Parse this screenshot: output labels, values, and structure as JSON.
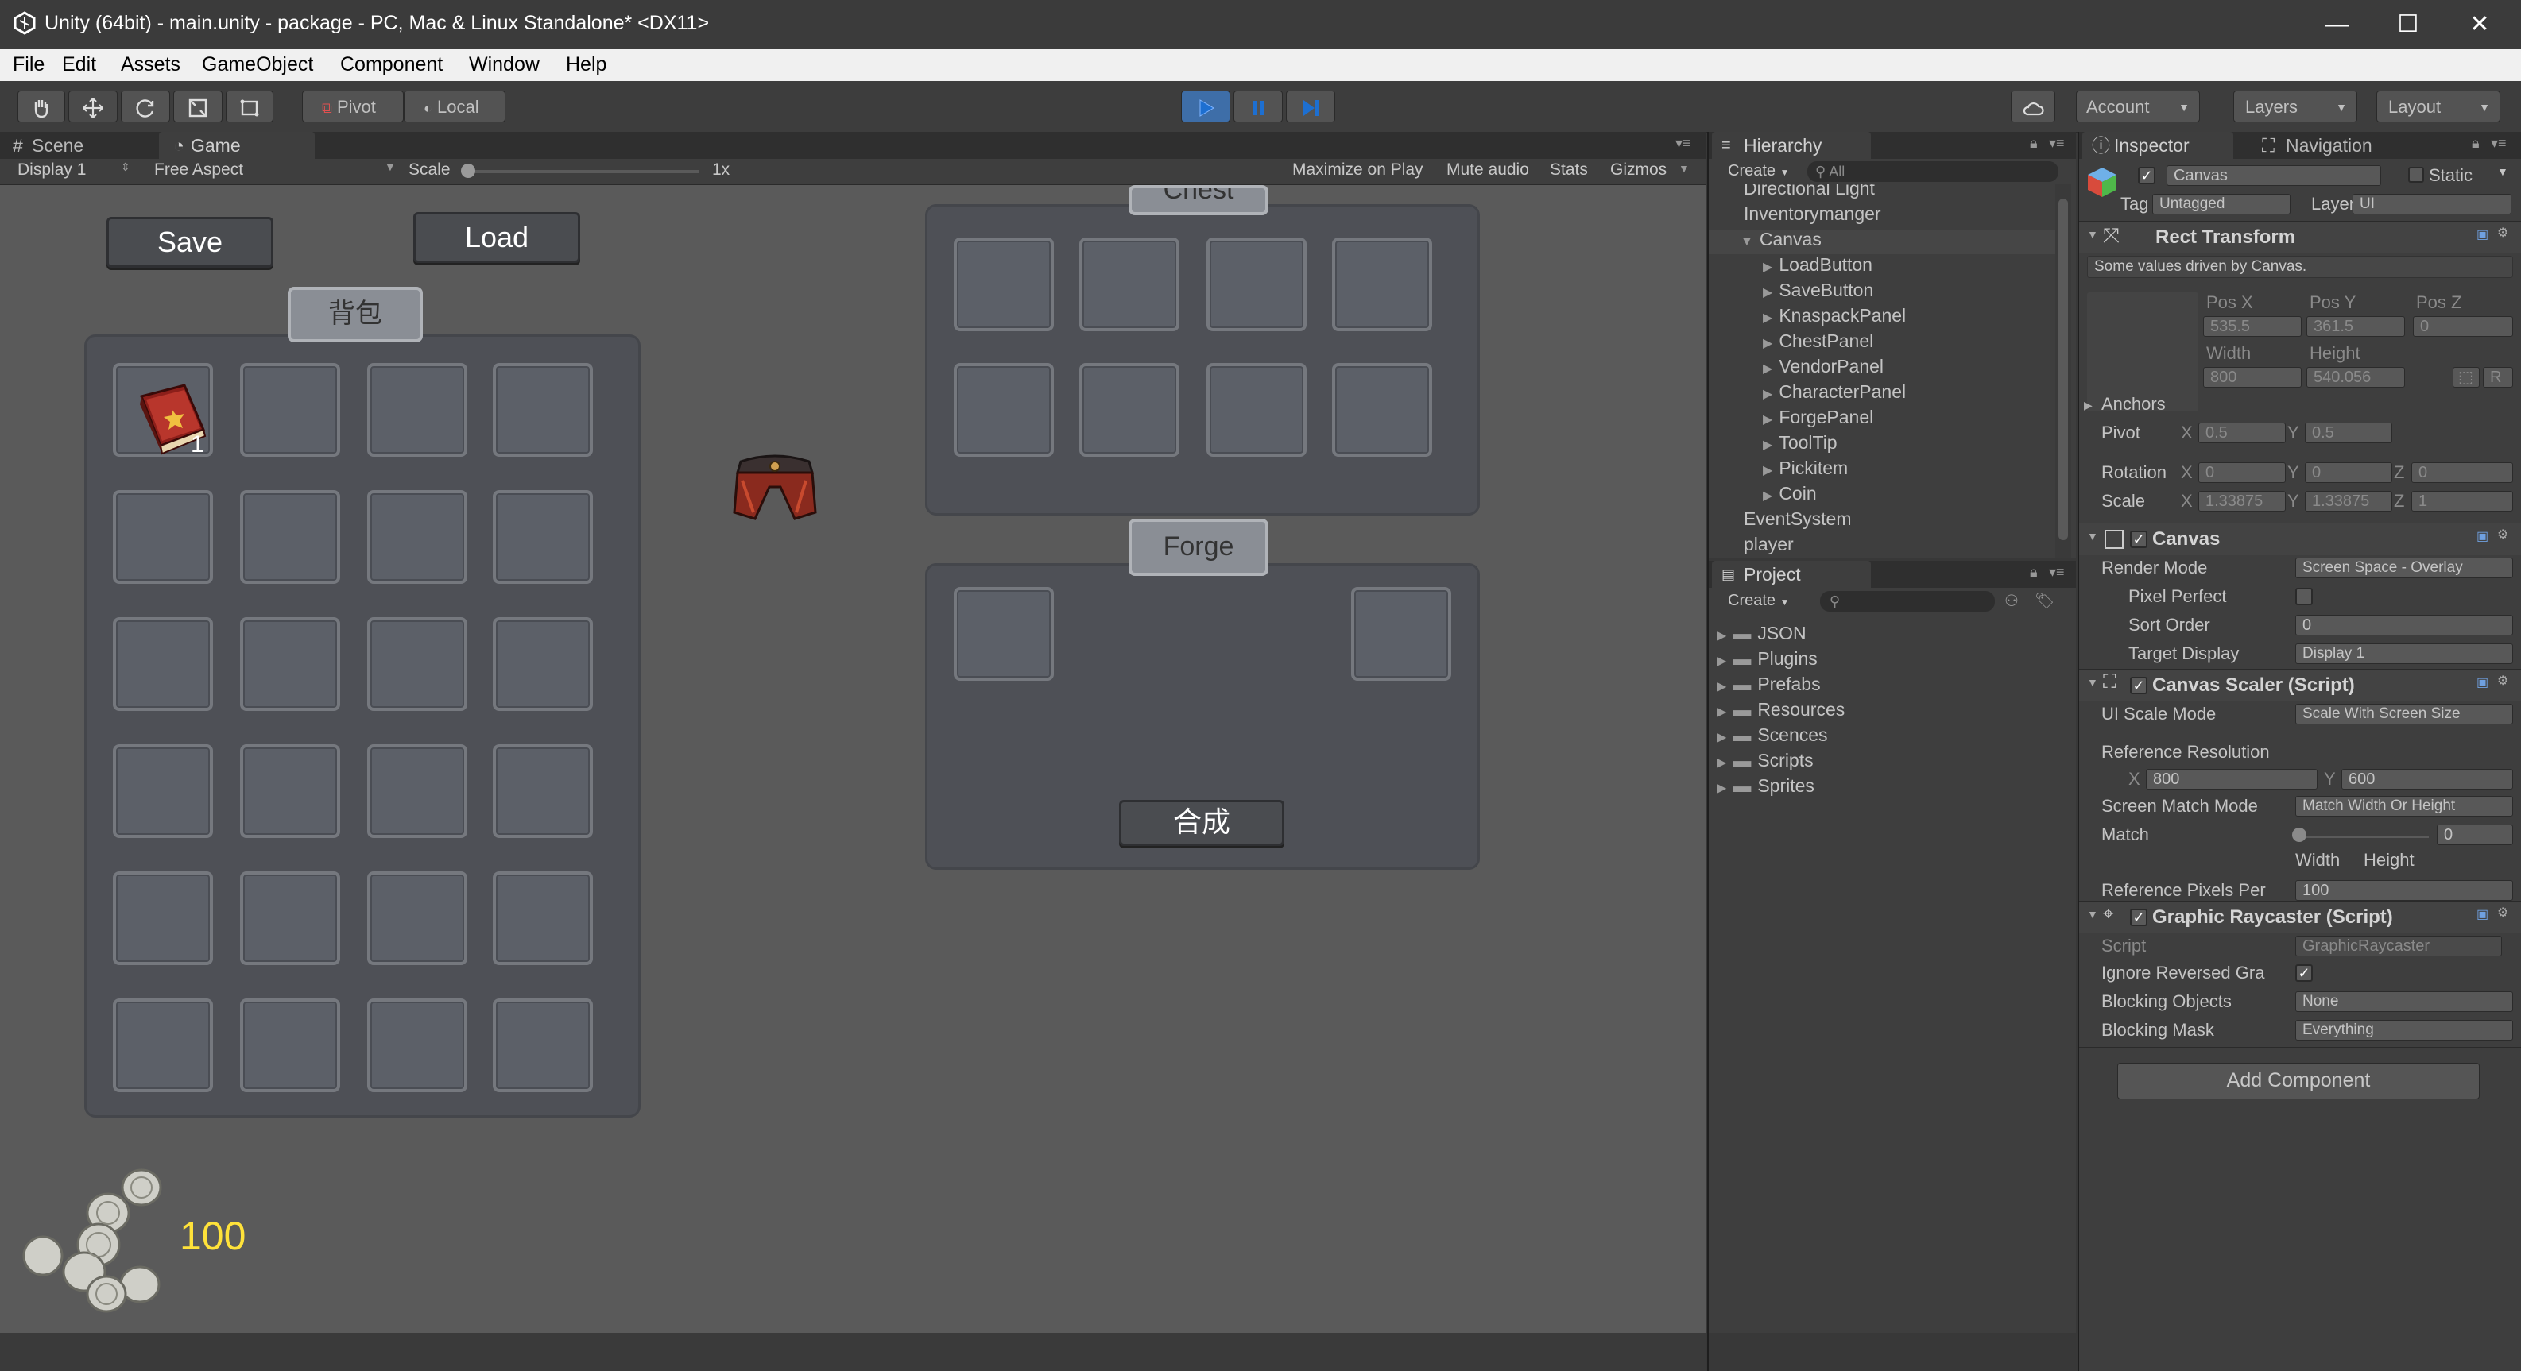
{
  "window": {
    "title": "Unity (64bit) - main.unity - package - PC, Mac & Linux Standalone* <DX11>",
    "minimize": "—",
    "maximize": "☐",
    "close": "✕"
  },
  "menu": [
    "File",
    "Edit",
    "Assets",
    "GameObject",
    "Component",
    "Window",
    "Help"
  ],
  "toolbar": {
    "pivot": "Pivot",
    "local": "Local",
    "account": "Account",
    "layers": "Layers",
    "layout": "Layout"
  },
  "game_view": {
    "tabs": [
      "Scene",
      "Game"
    ],
    "display": "Display 1",
    "aspect": "Free Aspect",
    "scale_label": "Scale",
    "scale_value": "1x",
    "options": [
      "Maximize on Play",
      "Mute audio",
      "Stats",
      "Gizmos"
    ],
    "save_button": "Save",
    "load_button": "Load",
    "bag_title": "背包",
    "book_count": "1",
    "chest_title": "Chest",
    "forge_title": "Forge",
    "craft_button": "合成",
    "coin_count": "100"
  },
  "hierarchy": {
    "tab": "Hierarchy",
    "create": "Create",
    "search": "All",
    "items": [
      {
        "label": "Directional Light",
        "indent": 0,
        "arrow": ""
      },
      {
        "label": "Inventorymanger",
        "indent": 0,
        "arrow": ""
      },
      {
        "label": "Canvas",
        "indent": 0,
        "arrow": "▼"
      },
      {
        "label": "LoadButton",
        "indent": 1,
        "arrow": "▶"
      },
      {
        "label": "SaveButton",
        "indent": 1,
        "arrow": "▶"
      },
      {
        "label": "KnaspackPanel",
        "indent": 1,
        "arrow": "▶"
      },
      {
        "label": "ChestPanel",
        "indent": 1,
        "arrow": "▶"
      },
      {
        "label": "VendorPanel",
        "indent": 1,
        "arrow": "▶"
      },
      {
        "label": "CharacterPanel",
        "indent": 1,
        "arrow": "▶"
      },
      {
        "label": "ForgePanel",
        "indent": 1,
        "arrow": "▶"
      },
      {
        "label": "ToolTip",
        "indent": 1,
        "arrow": "▶"
      },
      {
        "label": "Pickitem",
        "indent": 1,
        "arrow": "▶"
      },
      {
        "label": "Coin",
        "indent": 1,
        "arrow": "▶"
      },
      {
        "label": "EventSystem",
        "indent": 0,
        "arrow": ""
      },
      {
        "label": "player",
        "indent": 0,
        "arrow": ""
      }
    ]
  },
  "project": {
    "tab": "Project",
    "create": "Create",
    "folders": [
      "JSON",
      "Plugins",
      "Prefabs",
      "Resources",
      "Scences",
      "Scripts",
      "Sprites"
    ]
  },
  "inspector": {
    "tabs": [
      "Inspector",
      "Navigation"
    ],
    "object_name": "Canvas",
    "static_label": "Static",
    "tag_label": "Tag",
    "tag_value": "Untagged",
    "layer_label": "Layer",
    "layer_value": "UI",
    "rect_transform": {
      "title": "Rect Transform",
      "note": "Some values driven by Canvas.",
      "pos_x_label": "Pos X",
      "pos_y_label": "Pos Y",
      "pos_z_label": "Pos Z",
      "pos_x": "535.5",
      "pos_y": "361.5",
      "pos_z": "0",
      "width_label": "Width",
      "height_label": "Height",
      "width": "800",
      "height": "540.056",
      "r_button": "R",
      "anchors": "Anchors",
      "pivot_label": "Pivot",
      "pivot_x": "0.5",
      "pivot_y": "0.5",
      "rotation_label": "Rotation",
      "rot_x": "0",
      "rot_y": "0",
      "rot_z": "0",
      "scale_label": "Scale",
      "scale_x": "1.33875",
      "scale_y": "1.33875",
      "scale_z": "1",
      "x": "X",
      "y": "Y",
      "z": "Z"
    },
    "canvas": {
      "title": "Canvas",
      "render_mode_label": "Render Mode",
      "render_mode": "Screen Space - Overlay",
      "pixel_perfect_label": "Pixel Perfect",
      "sort_order_label": "Sort Order",
      "sort_order": "0",
      "target_display_label": "Target Display",
      "target_display": "Display 1"
    },
    "canvas_scaler": {
      "title": "Canvas Scaler (Script)",
      "ui_scale_mode_label": "UI Scale Mode",
      "ui_scale_mode": "Scale With Screen Size",
      "ref_res_label": "Reference Resolution",
      "ref_x": "800",
      "ref_y": "600",
      "screen_match_label": "Screen Match Mode",
      "screen_match": "Match Width Or Height",
      "match_label": "Match",
      "match_value": "0",
      "width_label": "Width",
      "height_label": "Height",
      "ref_pixels_label": "Reference Pixels Per",
      "ref_pixels": "100"
    },
    "graphic_raycaster": {
      "title": "Graphic Raycaster (Script)",
      "script_label": "Script",
      "script_value": "GraphicRaycaster",
      "ignore_label": "Ignore Reversed Gra",
      "blocking_objects_label": "Blocking Objects",
      "blocking_objects": "None",
      "blocking_mask_label": "Blocking Mask",
      "blocking_mask": "Everything"
    },
    "add_component": "Add Component"
  },
  "colors": {
    "play_blue": "#1d6fd1",
    "coin_yellow": "#ffe23a",
    "editor_bg": "#383838"
  }
}
